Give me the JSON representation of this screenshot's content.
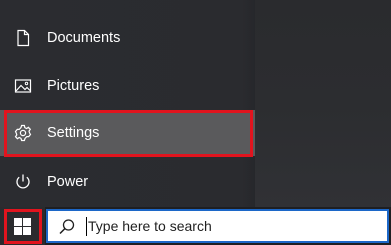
{
  "start_menu": {
    "items": [
      {
        "label": "Documents",
        "icon": "document-icon"
      },
      {
        "label": "Pictures",
        "icon": "pictures-icon"
      },
      {
        "label": "Settings",
        "icon": "gear-icon"
      },
      {
        "label": "Power",
        "icon": "power-icon"
      }
    ],
    "selected": "Settings"
  },
  "taskbar": {
    "start_icon": "windows-logo-icon",
    "search_placeholder": "Type here to search"
  },
  "colors": {
    "highlight": "#e1141e",
    "menu_bg": "#2b2c30",
    "selected_bg": "#5a5a5c",
    "search_border": "#1c67c8"
  }
}
